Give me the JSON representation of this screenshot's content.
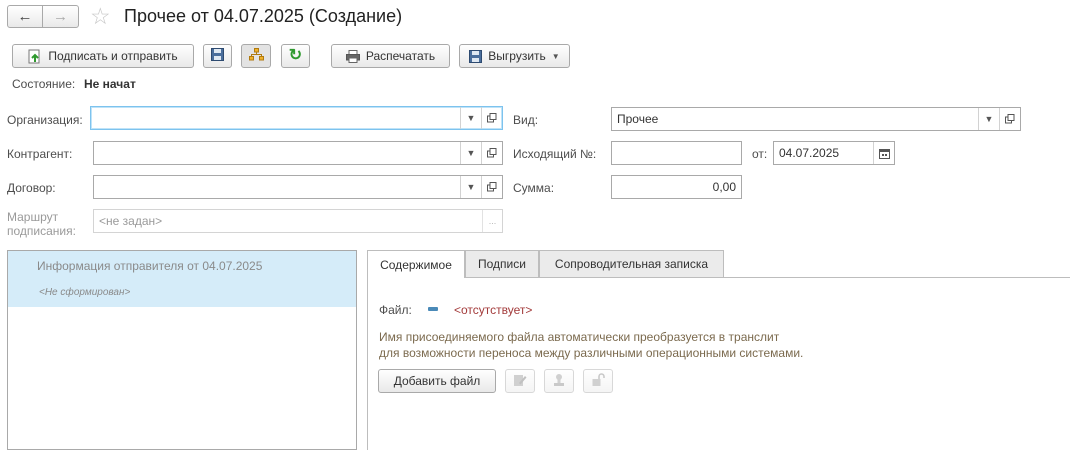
{
  "window": {
    "title": "Прочее от 04.07.2025 (Создание)"
  },
  "toolbar": {
    "sign_send_label": "Подписать и отправить",
    "print_label": "Распечатать",
    "export_label": "Выгрузить"
  },
  "status": {
    "label": "Состояние:",
    "value": "Не начат"
  },
  "form": {
    "organization_label": "Организация:",
    "organization_value": "",
    "counterparty_label": "Контрагент:",
    "counterparty_value": "",
    "contract_label": "Договор:",
    "contract_value": "",
    "route_label_line1": "Маршрут",
    "route_label_line2": "подписания:",
    "route_value": "<не задан>",
    "route_button": "...",
    "kind_label": "Вид:",
    "kind_value": "Прочее",
    "outgoing_label": "Исходящий №:",
    "outgoing_value": "",
    "date_label": "от:",
    "date_value": "04.07.2025",
    "sum_label": "Сумма:",
    "sum_value": "0,00"
  },
  "left_list": {
    "item_title": "Информация отправителя от 04.07.2025",
    "item_subtitle": "<Не сформирован>"
  },
  "tabs": [
    {
      "label": "Содержимое",
      "active": true
    },
    {
      "label": "Подписи",
      "active": false
    },
    {
      "label": "Сопроводительная записка",
      "active": false
    }
  ],
  "content": {
    "file_label": "Файл:",
    "file_value": "<отсутствует>",
    "hint_line1": "Имя присоединяемого файла автоматически преобразуется в транслит",
    "hint_line2": "для возможности переноса между различными операционными системами.",
    "add_file_label": "Добавить файл"
  },
  "colors": {
    "accent_orange": "#e8a020",
    "selection_blue": "#d5ecf9",
    "file_value_red": "#a33b3b",
    "hint_brown": "#7b6a4e",
    "refresh_green": "#2f9a2f"
  }
}
